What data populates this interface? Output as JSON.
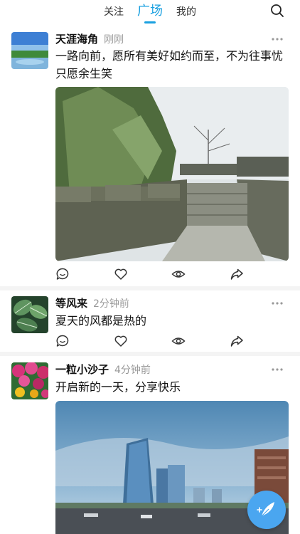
{
  "tabs": [
    {
      "label": "关注",
      "active": false
    },
    {
      "label": "广场",
      "active": true
    },
    {
      "label": "我的",
      "active": false
    }
  ],
  "accent_color": "#1aa0e0",
  "posts": [
    {
      "username": "天涯海角",
      "time": "刚刚",
      "content": "一路向前，愿所有美好如约而至，不为往事忧只愿余生笑",
      "image": "castle-wall-photo"
    },
    {
      "username": "等风来",
      "time": "2分钟前",
      "content": "夏天的风都是热的"
    },
    {
      "username": "一粒小沙子",
      "time": "4分钟前",
      "content": "开启新的一天，分享快乐",
      "image": "city-buildings-photo"
    }
  ],
  "icons": {
    "search": "search-icon",
    "more": "more-icon",
    "comment": "comment-icon",
    "like": "heart-icon",
    "view": "eye-icon",
    "share": "share-icon",
    "compose": "quill-icon"
  }
}
